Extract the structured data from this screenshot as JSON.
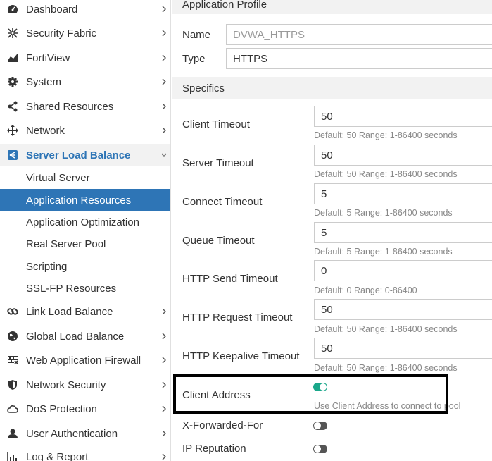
{
  "sidebar": {
    "items": [
      {
        "label": "Dashboard",
        "icon": "dashboard-icon"
      },
      {
        "label": "Security Fabric",
        "icon": "security-fabric-icon"
      },
      {
        "label": "FortiView",
        "icon": "fortiview-icon"
      },
      {
        "label": "System",
        "icon": "gear-icon"
      },
      {
        "label": "Shared Resources",
        "icon": "share-icon"
      },
      {
        "label": "Network",
        "icon": "network-arrows-icon"
      },
      {
        "label": "Server Load Balance",
        "icon": "server-load-balance-icon"
      },
      {
        "label": "Link Load Balance",
        "icon": "link-icon"
      },
      {
        "label": "Global Load Balance",
        "icon": "globe-icon"
      },
      {
        "label": "Web Application Firewall",
        "icon": "waf-icon"
      },
      {
        "label": "Network Security",
        "icon": "shield-icon"
      },
      {
        "label": "DoS Protection",
        "icon": "cloud-icon"
      },
      {
        "label": "User Authentication",
        "icon": "user-icon"
      },
      {
        "label": "Log & Report",
        "icon": "chart-icon"
      }
    ],
    "submenu": [
      {
        "label": "Virtual Server"
      },
      {
        "label": "Application Resources"
      },
      {
        "label": "Application Optimization"
      },
      {
        "label": "Real Server Pool"
      },
      {
        "label": "Scripting"
      },
      {
        "label": "SSL-FP Resources"
      }
    ]
  },
  "profile": {
    "section_title": "Application Profile",
    "name_label": "Name",
    "name_value": "DVWA_HTTPS",
    "type_label": "Type",
    "type_value": "HTTPS"
  },
  "specifics": {
    "section_title": "Specifics",
    "fields": [
      {
        "label": "Client Timeout",
        "value": "50",
        "hint": "Default: 50 Range: 1-86400 seconds"
      },
      {
        "label": "Server Timeout",
        "value": "50",
        "hint": "Default: 50 Range: 1-86400 seconds"
      },
      {
        "label": "Connect Timeout",
        "value": "5",
        "hint": "Default: 5 Range: 1-86400 seconds"
      },
      {
        "label": "Queue Timeout",
        "value": "5",
        "hint": "Default: 5 Range: 1-86400 seconds"
      },
      {
        "label": "HTTP Send Timeout",
        "value": "0",
        "hint": "Default: 0 Range: 0-86400"
      },
      {
        "label": "HTTP Request Timeout",
        "value": "50",
        "hint": "Default: 50 Range: 1-86400 seconds"
      },
      {
        "label": "HTTP Keepalive Timeout",
        "value": "50",
        "hint": "Default: 50 Range: 1-86400 seconds"
      }
    ],
    "client_address": {
      "label": "Client Address",
      "enabled": true,
      "hint": "Use Client Address to connect to pool"
    },
    "x_forwarded_for": {
      "label": "X-Forwarded-For",
      "enabled": false
    },
    "ip_reputation": {
      "label": "IP Reputation",
      "enabled": false
    }
  },
  "colors": {
    "accent": "#2e75b6",
    "toggle_on": "#1aa78a",
    "toggle_off": "#555555"
  }
}
